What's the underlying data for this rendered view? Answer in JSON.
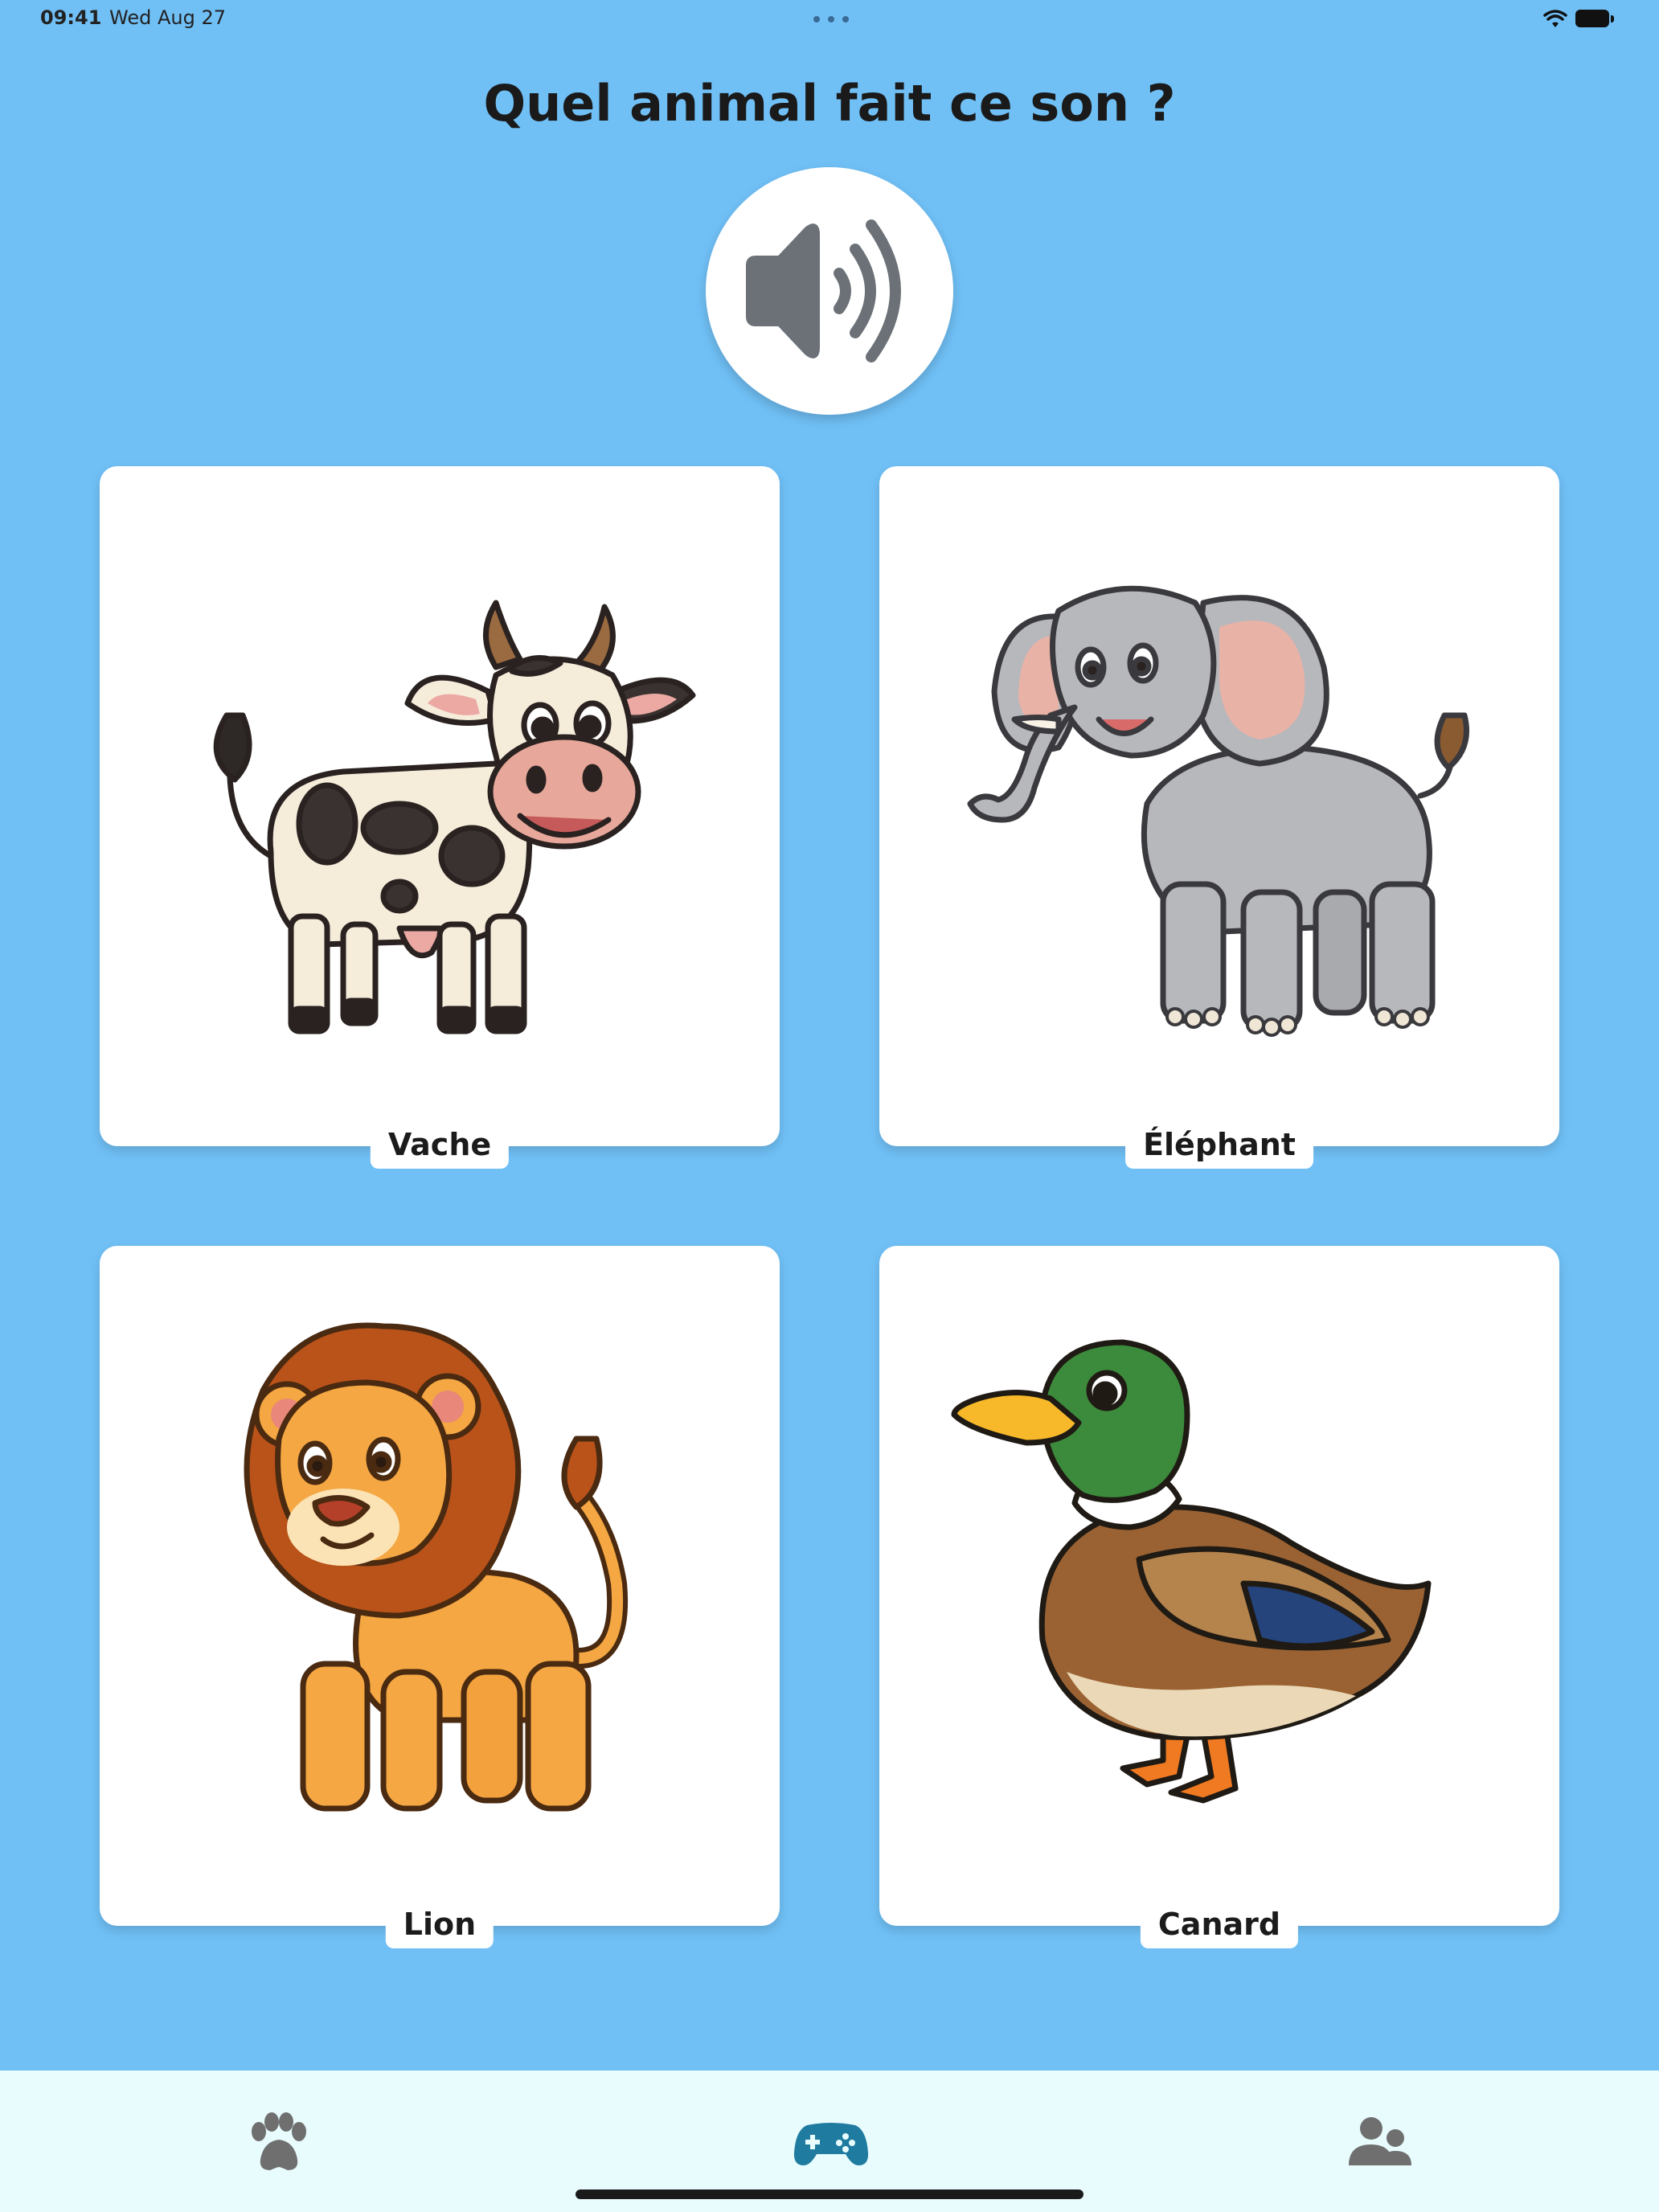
{
  "status_bar": {
    "time": "09:41",
    "date": "Wed Aug 27"
  },
  "question": {
    "title": "Quel animal fait ce son ?"
  },
  "sound_button": {
    "icon": "speaker-icon"
  },
  "cards": [
    {
      "label": "Vache",
      "icon": "cow-illustration"
    },
    {
      "label": "Éléphant",
      "icon": "elephant-illustration"
    },
    {
      "label": "Lion",
      "icon": "lion-illustration"
    },
    {
      "label": "Canard",
      "icon": "duck-illustration"
    }
  ],
  "tab_bar": {
    "tabs": [
      {
        "icon": "paw-icon",
        "active": false
      },
      {
        "icon": "gamepad-icon",
        "active": true
      },
      {
        "icon": "users-icon",
        "active": false
      }
    ]
  },
  "colors": {
    "background": "#70c0f6",
    "card": "#ffffff",
    "tab_bar": "#e8fcfd",
    "active_tab": "#1f7ba0",
    "inactive_tab": "#6f6f6f",
    "speaker": "#6b7177"
  }
}
